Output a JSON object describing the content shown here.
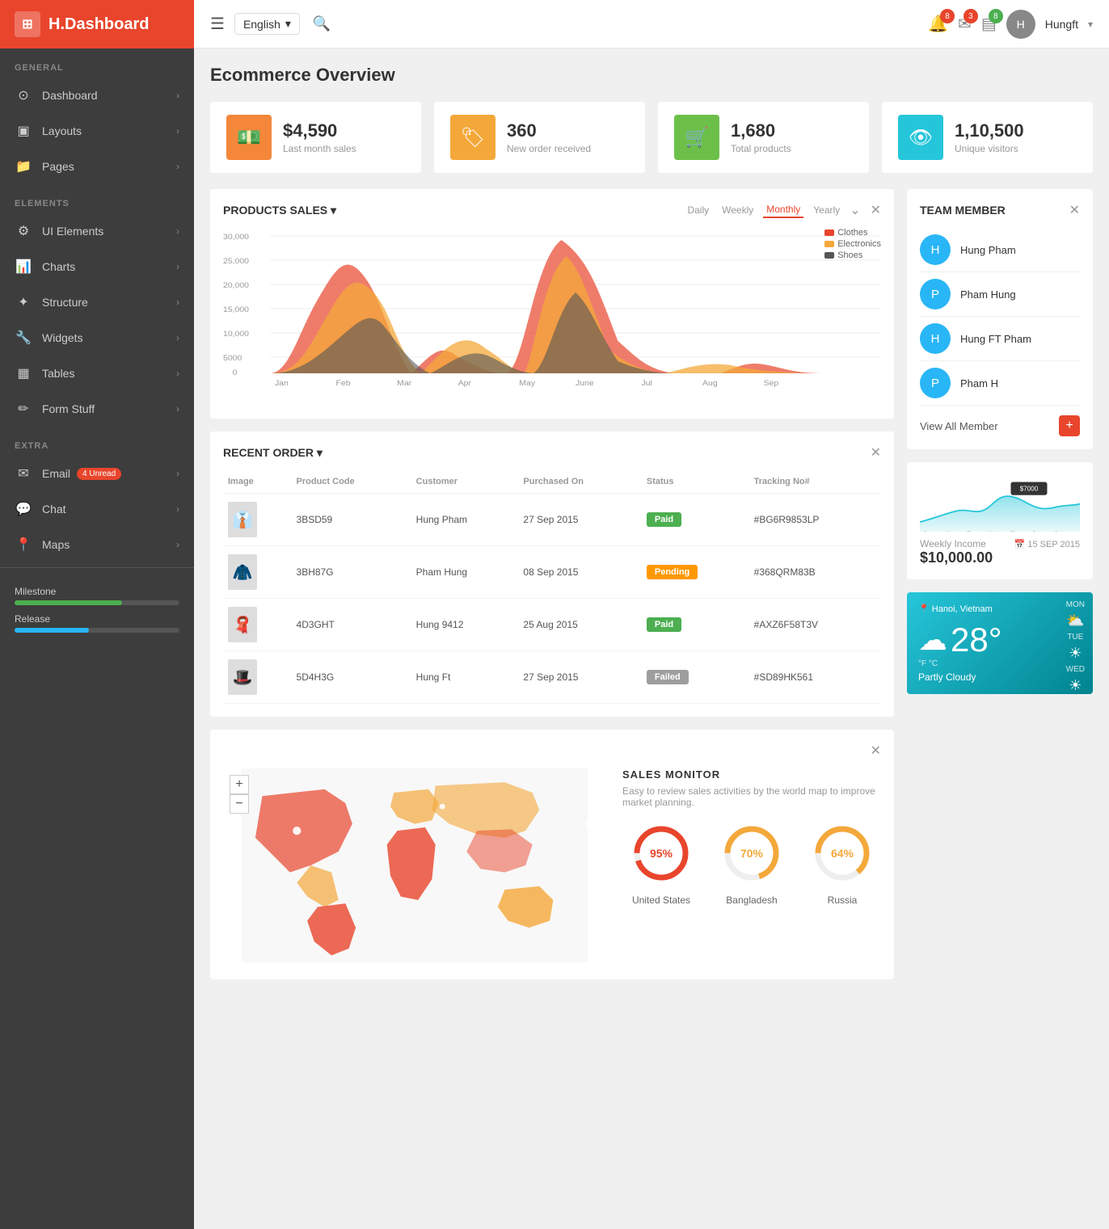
{
  "app": {
    "name": "H.Dashboard",
    "logo_icon": "⊞"
  },
  "topbar": {
    "menu_icon": "☰",
    "language": "English",
    "search_icon": "🔍",
    "notifications_count": "8",
    "messages_count": "3",
    "alerts_count": "8",
    "username": "Hungft",
    "avatar_initials": "H"
  },
  "sidebar": {
    "sections": [
      {
        "label": "GENERAL",
        "items": [
          {
            "id": "dashboard",
            "label": "Dashboard",
            "icon": "⊙",
            "has_chevron": true
          },
          {
            "id": "layouts",
            "label": "Layouts",
            "icon": "▣",
            "has_chevron": true
          },
          {
            "id": "pages",
            "label": "Pages",
            "icon": "📁",
            "has_chevron": true
          }
        ]
      },
      {
        "label": "ELEMENTS",
        "items": [
          {
            "id": "ui-elements",
            "label": "UI Elements",
            "icon": "⚙",
            "has_chevron": true
          },
          {
            "id": "charts",
            "label": "Charts",
            "icon": "📊",
            "has_chevron": true
          },
          {
            "id": "structure",
            "label": "Structure",
            "icon": "✦",
            "has_chevron": true
          },
          {
            "id": "widgets",
            "label": "Widgets",
            "icon": "🔧",
            "has_chevron": true
          },
          {
            "id": "tables",
            "label": "Tables",
            "icon": "▦",
            "has_chevron": true
          },
          {
            "id": "form-stuff",
            "label": "Form Stuff",
            "icon": "✏",
            "has_chevron": true
          }
        ]
      },
      {
        "label": "EXTRA",
        "items": [
          {
            "id": "email",
            "label": "Email",
            "icon": "✉",
            "has_chevron": true,
            "badge": "4 Unread"
          },
          {
            "id": "chat",
            "label": "Chat",
            "icon": "💬",
            "has_chevron": true
          },
          {
            "id": "maps",
            "label": "Maps",
            "icon": "📍",
            "has_chevron": true
          }
        ]
      }
    ],
    "progress": [
      {
        "label": "Milestone",
        "value": 65,
        "color": "#4caf50"
      },
      {
        "label": "Release",
        "value": 45,
        "color": "#29b6f6"
      }
    ]
  },
  "page": {
    "title": "Ecommerce Overview"
  },
  "stats": [
    {
      "id": "sales",
      "icon": "💵",
      "bg_color": "#f4873a",
      "value": "$4,590",
      "label": "Last month sales"
    },
    {
      "id": "orders",
      "icon": "🏷",
      "bg_color": "#f4a83a",
      "value": "360",
      "label": "New order received"
    },
    {
      "id": "products",
      "icon": "🛒",
      "bg_color": "#6cc04a",
      "value": "1,680",
      "label": "Total products"
    },
    {
      "id": "visitors",
      "icon": "👁",
      "bg_color": "#26c6da",
      "value": "1,10,500",
      "label": "Unique visitors"
    }
  ],
  "products_sales_chart": {
    "title": "PRODUCTS SALES",
    "tabs": [
      "Daily",
      "Weekly",
      "Monthly",
      "Yearly"
    ],
    "active_tab": "Monthly",
    "legend": [
      {
        "label": "Clothes",
        "color": "#e8452c"
      },
      {
        "label": "Electronics",
        "color": "#f4a83a"
      },
      {
        "label": "Shoes",
        "color": "#555"
      }
    ],
    "y_labels": [
      "30,000",
      "25,000",
      "20,000",
      "15,000",
      "10,000",
      "5000",
      "0"
    ],
    "x_labels": [
      "Jan",
      "Feb",
      "Mar",
      "Apr",
      "May",
      "June",
      "Jul",
      "Aug",
      "Sep"
    ]
  },
  "team_member": {
    "title": "TEAM MEMBER",
    "members": [
      {
        "name": "Hung Pham",
        "color": "#29b6f6"
      },
      {
        "name": "Pham Hung",
        "color": "#29b6f6"
      },
      {
        "name": "Hung FT Pham",
        "color": "#29b6f6"
      },
      {
        "name": "Pham H",
        "color": "#29b6f6"
      }
    ],
    "view_all_label": "View All Member",
    "add_icon": "+"
  },
  "weekly_income": {
    "label": "Weekly Income",
    "value": "$10,000.00",
    "date": "15 SEP 2015",
    "tooltip": "$7000",
    "days": [
      "Sun",
      "Mon",
      "Tue",
      "Wed",
      "Thu",
      "Fri",
      "Sat"
    ]
  },
  "weather": {
    "location": "Hanoi, Vietnam",
    "temp": "28°",
    "desc": "Partly Cloudy",
    "temp_f": "°F",
    "temp_c": "°C",
    "forecast": [
      {
        "day": "MON",
        "icon": "⛅"
      },
      {
        "day": "TUE",
        "icon": "☀"
      },
      {
        "day": "WED",
        "icon": "☀"
      }
    ]
  },
  "recent_order": {
    "title": "RECENT ORDER",
    "headers": [
      "Image",
      "Product Code",
      "Customer",
      "Purchased On",
      "Status",
      "Tracking No#"
    ],
    "rows": [
      {
        "code": "3BSD59",
        "customer": "Hung Pham",
        "date": "27 Sep 2015",
        "status": "Paid",
        "tracking": "#BG6R9853LP",
        "status_type": "paid"
      },
      {
        "code": "3BH87G",
        "customer": "Pham Hung",
        "date": "08 Sep 2015",
        "status": "Pending",
        "tracking": "#368QRM83B",
        "status_type": "pending"
      },
      {
        "code": "4D3GHT",
        "customer": "Hung 9412",
        "date": "25 Aug 2015",
        "status": "Paid",
        "tracking": "#AXZ6F58T3V",
        "status_type": "paid"
      },
      {
        "code": "5D4H3G",
        "customer": "Hung Ft",
        "date": "27 Sep 2015",
        "status": "Failed",
        "tracking": "#SD89HK561",
        "status_type": "failed"
      }
    ]
  },
  "sales_monitor": {
    "title": "SALES MONITOR",
    "description": "Easy to review sales activities by the world map to improve market planning.",
    "donuts": [
      {
        "label": "United States",
        "value": 95,
        "color": "#e8452c",
        "bg": "#eee"
      },
      {
        "label": "Bangladesh",
        "value": 70,
        "color": "#f4a83a",
        "bg": "#eee"
      },
      {
        "label": "Russia",
        "value": 64,
        "color": "#f4a83a",
        "bg": "#eee"
      }
    ],
    "zoom_in": "+",
    "zoom_out": "-"
  }
}
